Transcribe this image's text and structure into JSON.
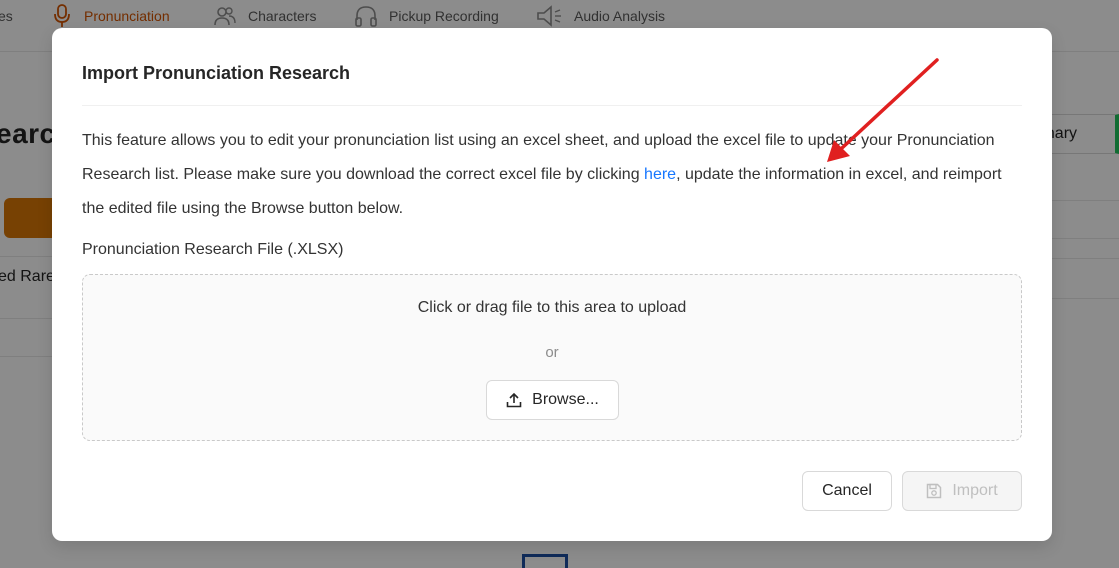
{
  "nav": {
    "cut_label": "es",
    "items": [
      {
        "label": "Pronunciation",
        "icon": "microphone-icon",
        "active": true
      },
      {
        "label": "Characters",
        "icon": "users-icon",
        "active": false
      },
      {
        "label": "Pickup Recording",
        "icon": "headphones-icon",
        "active": false
      },
      {
        "label": "Audio Analysis",
        "icon": "speaker-icon",
        "active": false
      }
    ]
  },
  "background": {
    "heading_fragment": "earc",
    "row_label_fragment": "ed Rare",
    "dictionary_button_fragment": "onary"
  },
  "modal": {
    "title": "Import Pronunciation Research",
    "description_before_link": "This feature allows you to edit your pronunciation list using an excel sheet, and upload the excel file to update your Pronunciation Research list. Please make sure you download the correct excel file by clicking ",
    "link_text": "here",
    "description_after_link": ", update the information in excel, and reimport the edited file using the Browse button below.",
    "file_label": "Pronunciation Research File (.XLSX)",
    "dropzone": {
      "title": "Click or drag file to this area to upload",
      "or_text": "or",
      "browse_label": "Browse..."
    },
    "cancel_label": "Cancel",
    "import_label": "Import"
  },
  "colors": {
    "accent_active_nav": "#d35400",
    "link": "#1677ff",
    "annotation_arrow": "#e02020",
    "overlay": "rgba(0,0,0,0.45)"
  }
}
